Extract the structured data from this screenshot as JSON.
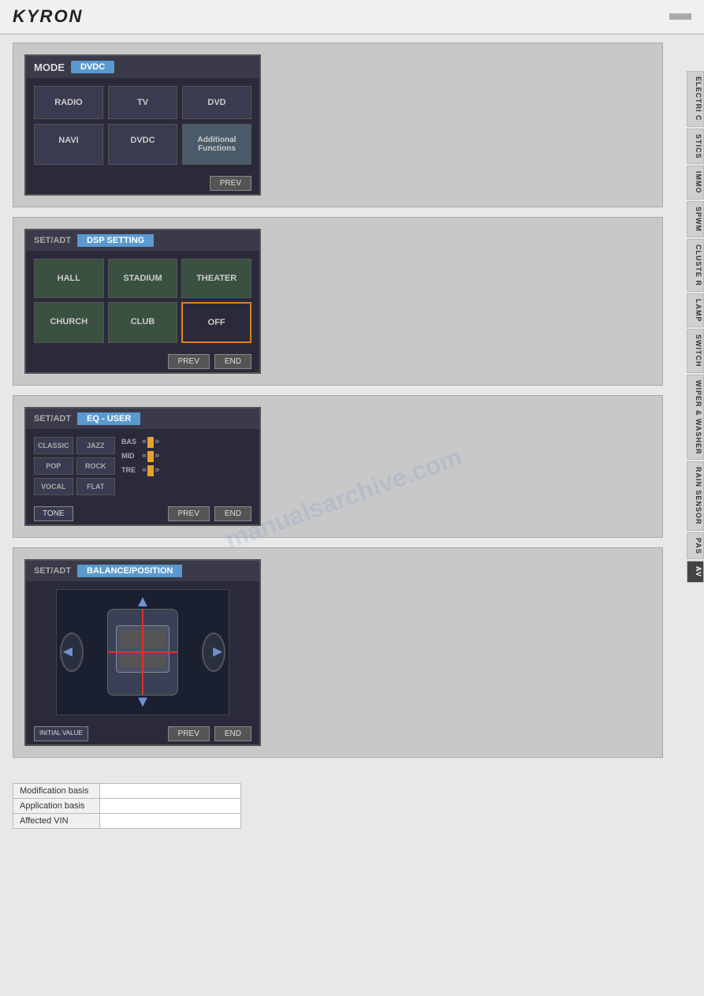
{
  "header": {
    "brand": "KYRON",
    "page_number": ""
  },
  "tabs": {
    "items": [
      {
        "id": "electric",
        "label": "ELECTRI\nC"
      },
      {
        "id": "stics",
        "label": "STICS"
      },
      {
        "id": "immo",
        "label": "IMMO"
      },
      {
        "id": "spwm",
        "label": "SPWM"
      },
      {
        "id": "cluster",
        "label": "CLUSTE\nR"
      },
      {
        "id": "lamp",
        "label": "LAMP"
      },
      {
        "id": "switch",
        "label": "SWITCH"
      },
      {
        "id": "wiper",
        "label": "WIPER &\nWASHER"
      },
      {
        "id": "rain",
        "label": "RAIN\nSENSOR"
      },
      {
        "id": "pas",
        "label": "PAS"
      },
      {
        "id": "av",
        "label": "AV",
        "active": true
      }
    ]
  },
  "section1": {
    "mode_label": "MODE",
    "mode_value": "DVDC",
    "buttons": [
      {
        "label": "RADIO"
      },
      {
        "label": "TV"
      },
      {
        "label": "DVD"
      },
      {
        "label": "NAVI"
      },
      {
        "label": "DVDC"
      },
      {
        "label": "Additional\nFunctions"
      }
    ],
    "prev_label": "PREV"
  },
  "section2": {
    "setadt_label": "SET/ADT",
    "title": "DSP SETTING",
    "buttons": [
      {
        "label": "HALL"
      },
      {
        "label": "STADIUM"
      },
      {
        "label": "THEATER"
      },
      {
        "label": "CHURCH"
      },
      {
        "label": "CLUB"
      },
      {
        "label": "OFF",
        "active": true
      }
    ],
    "prev_label": "PREV",
    "end_label": "END"
  },
  "section3": {
    "setadt_label": "SET/ADT",
    "title": "EQ - USER",
    "presets": [
      {
        "label": "CLASSIC"
      },
      {
        "label": "JAZZ"
      },
      {
        "label": "POP"
      },
      {
        "label": "ROCK"
      },
      {
        "label": "VOCAL"
      },
      {
        "label": "FLAT"
      }
    ],
    "sliders": [
      {
        "id": "bas",
        "label": "BAS",
        "value": 50
      },
      {
        "id": "mid",
        "label": "MID",
        "value": 50
      },
      {
        "id": "tre",
        "label": "TRE",
        "value": 50
      }
    ],
    "tone_label": "TONE",
    "prev_label": "PREV",
    "end_label": "END"
  },
  "section4": {
    "setadt_label": "SET/ADT",
    "title": "BALANCE/POSITION",
    "initial_value_label": "INITIAL\nVALUE",
    "prev_label": "PREV",
    "end_label": "END"
  },
  "bottom_table": {
    "rows": [
      {
        "label": "Modification basis",
        "value": ""
      },
      {
        "label": "Application basis",
        "value": ""
      },
      {
        "label": "Affected VIN",
        "value": ""
      }
    ]
  },
  "watermark": "manualsarchive.com"
}
